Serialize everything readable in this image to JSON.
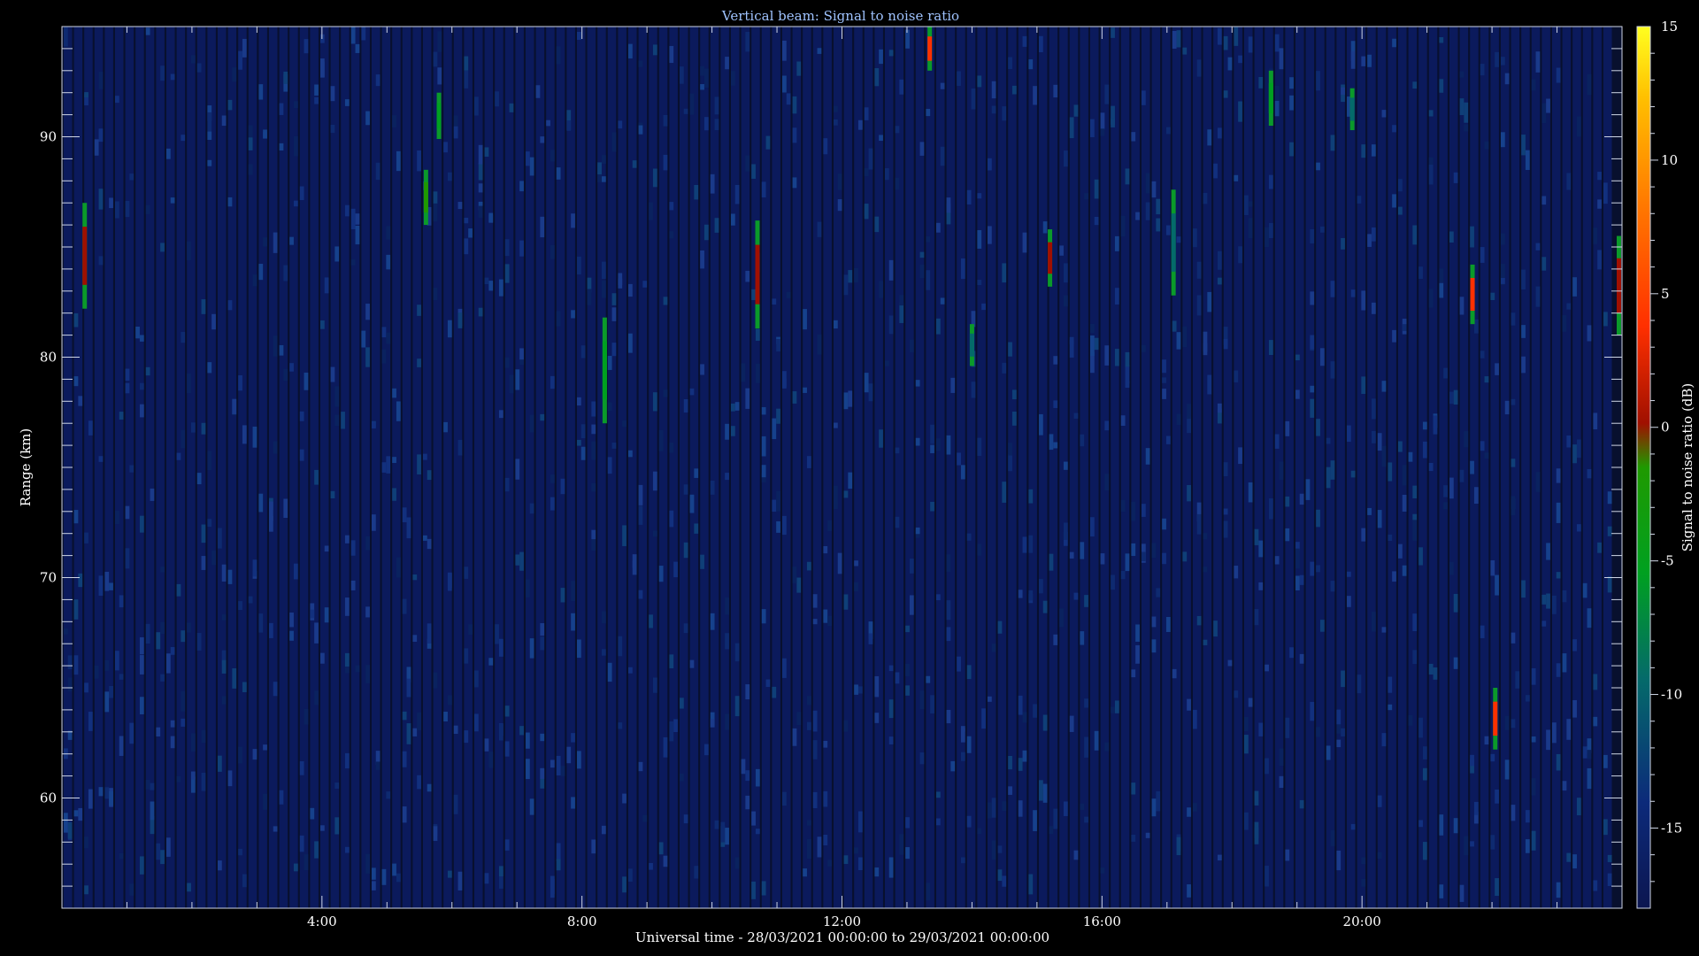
{
  "chart_data": {
    "type": "heatmap",
    "title": "Vertical beam: Signal to noise ratio",
    "xlabel": "Universal time - 28/03/2021 00:00:00 to 29/03/2021 00:00:00",
    "ylabel": "Range (km)",
    "colorbar_label": "Signal to noise ratio (dB)",
    "x_unit": "hours",
    "xlim": [
      0,
      24
    ],
    "ylim": [
      55,
      95
    ],
    "x_ticks": [
      {
        "value": 4,
        "label": "4:00"
      },
      {
        "value": 8,
        "label": "8:00"
      },
      {
        "value": 12,
        "label": "12:00"
      },
      {
        "value": 16,
        "label": "16:00"
      },
      {
        "value": 20,
        "label": "20:00"
      }
    ],
    "y_ticks": [
      {
        "value": 60,
        "label": "60"
      },
      {
        "value": 70,
        "label": "70"
      },
      {
        "value": 80,
        "label": "80"
      },
      {
        "value": 90,
        "label": "90"
      }
    ],
    "colorbar_range": [
      -18,
      15
    ],
    "colorbar_ticks": [
      {
        "value": -15,
        "label": "-15"
      },
      {
        "value": -10,
        "label": "-10"
      },
      {
        "value": -5,
        "label": "-5"
      },
      {
        "value": 0,
        "label": "0"
      },
      {
        "value": 5,
        "label": "5"
      },
      {
        "value": 10,
        "label": "10"
      },
      {
        "value": 15,
        "label": "15"
      }
    ],
    "background_level_db": -15,
    "echoes": [
      {
        "t": 0.35,
        "r0": 82.2,
        "r1": 87.0,
        "peak_db": 1
      },
      {
        "t": 5.6,
        "r0": 86.0,
        "r1": 88.5,
        "peak_db": -2
      },
      {
        "t": 5.8,
        "r0": 89.9,
        "r1": 92.0,
        "peak_db": -5
      },
      {
        "t": 8.35,
        "r0": 77.0,
        "r1": 81.8,
        "peak_db": -3
      },
      {
        "t": 10.7,
        "r0": 81.3,
        "r1": 86.2,
        "peak_db": 1
      },
      {
        "t": 13.35,
        "r0": 93.0,
        "r1": 95.0,
        "peak_db": 4
      },
      {
        "t": 14.0,
        "r0": 79.6,
        "r1": 81.5,
        "peak_db": -8
      },
      {
        "t": 15.2,
        "r0": 83.2,
        "r1": 85.8,
        "peak_db": 1
      },
      {
        "t": 17.1,
        "r0": 82.8,
        "r1": 87.6,
        "peak_db": -6
      },
      {
        "t": 18.6,
        "r0": 90.5,
        "r1": 93.0,
        "peak_db": -4
      },
      {
        "t": 19.85,
        "r0": 90.3,
        "r1": 92.2,
        "peak_db": -6
      },
      {
        "t": 21.7,
        "r0": 81.5,
        "r1": 84.2,
        "peak_db": 3
      },
      {
        "t": 22.05,
        "r0": 62.2,
        "r1": 65.0,
        "peak_db": 3
      },
      {
        "t": 24.0,
        "r0": 81.0,
        "r1": 85.5,
        "peak_db": 1
      }
    ]
  }
}
